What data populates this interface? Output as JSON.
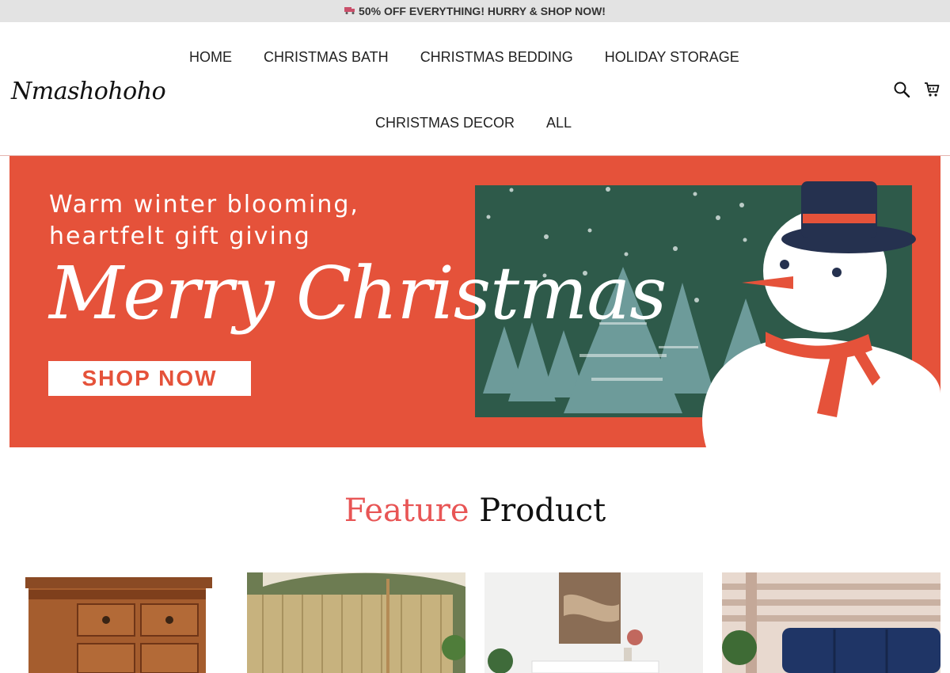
{
  "announcement": {
    "text": "50% OFF EVERYTHING! HURRY & SHOP NOW!",
    "icon": "truck-icon"
  },
  "header": {
    "logo": "Nmashohoho",
    "nav": [
      {
        "label": "HOME"
      },
      {
        "label": "CHRISTMAS BATH"
      },
      {
        "label": "CHRISTMAS BEDDING"
      },
      {
        "label": "HOLIDAY STORAGE"
      },
      {
        "label": "CHRISTMAS DECOR"
      },
      {
        "label": "ALL"
      }
    ],
    "icons": [
      "search-icon",
      "cart-icon"
    ]
  },
  "banner": {
    "subtitle_line1": "Warm winter blooming,",
    "subtitle_line2": "heartfelt gift giving",
    "title": "Merry Christmas",
    "cta": "SHOP NOW"
  },
  "feature": {
    "title_accent": "Feature",
    "title_rest": "Product"
  },
  "products": [
    {
      "image": "wooden-cabinet"
    },
    {
      "image": "wooden-fence-with-umbrella"
    },
    {
      "image": "white-sideboard-with-art"
    },
    {
      "image": "wooden-bench-with-blue-cushions"
    }
  ],
  "colors": {
    "banner": "#e5523a",
    "accent": "#e85555",
    "announce_bg": "#e3e3e3"
  }
}
